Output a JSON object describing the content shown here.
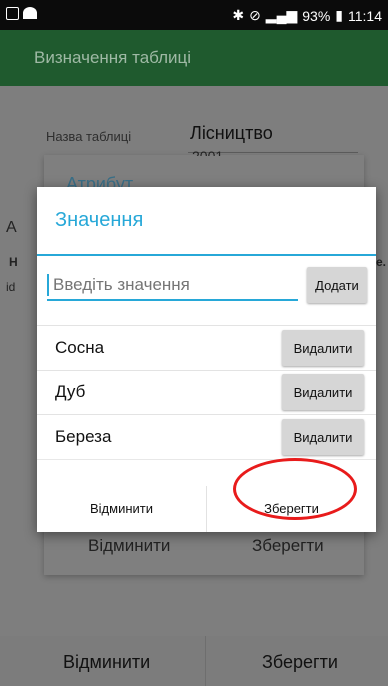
{
  "status_bar": {
    "battery": "93%",
    "time": "11:14",
    "icons": [
      "sim-icon",
      "wifi-icon",
      "bluetooth-icon",
      "mute-icon",
      "signal-icon",
      "battery-icon"
    ]
  },
  "app_bar": {
    "title": "Визначення таблиці"
  },
  "table_name": {
    "label": "Назва таблиці",
    "value": "Лісництво"
  },
  "background": {
    "peek_number": "2001",
    "attribute_partial": "Атрибут",
    "left_a": "А",
    "left_n": "Н",
    "left_id": "id",
    "right_e": "е.",
    "cancel_label": "Відминити",
    "save_label": "Зберегти"
  },
  "dialog": {
    "title": "Значення",
    "input_placeholder": "Введіть значення",
    "add_label": "Додати",
    "rows": [
      {
        "label": "Сосна",
        "delete_label": "Видалити"
      },
      {
        "label": "Дуб",
        "delete_label": "Видалити"
      },
      {
        "label": "Береза",
        "delete_label": "Видалити"
      }
    ],
    "cancel_label": "Відминити",
    "save_label": "Зберегти"
  },
  "bottom": {
    "cancel_label": "Відминити",
    "save_label": "Зберегти"
  },
  "colors": {
    "accent": "#27a8d8",
    "appbar": "#1f5a2e",
    "highlight": "#e81b1b"
  }
}
